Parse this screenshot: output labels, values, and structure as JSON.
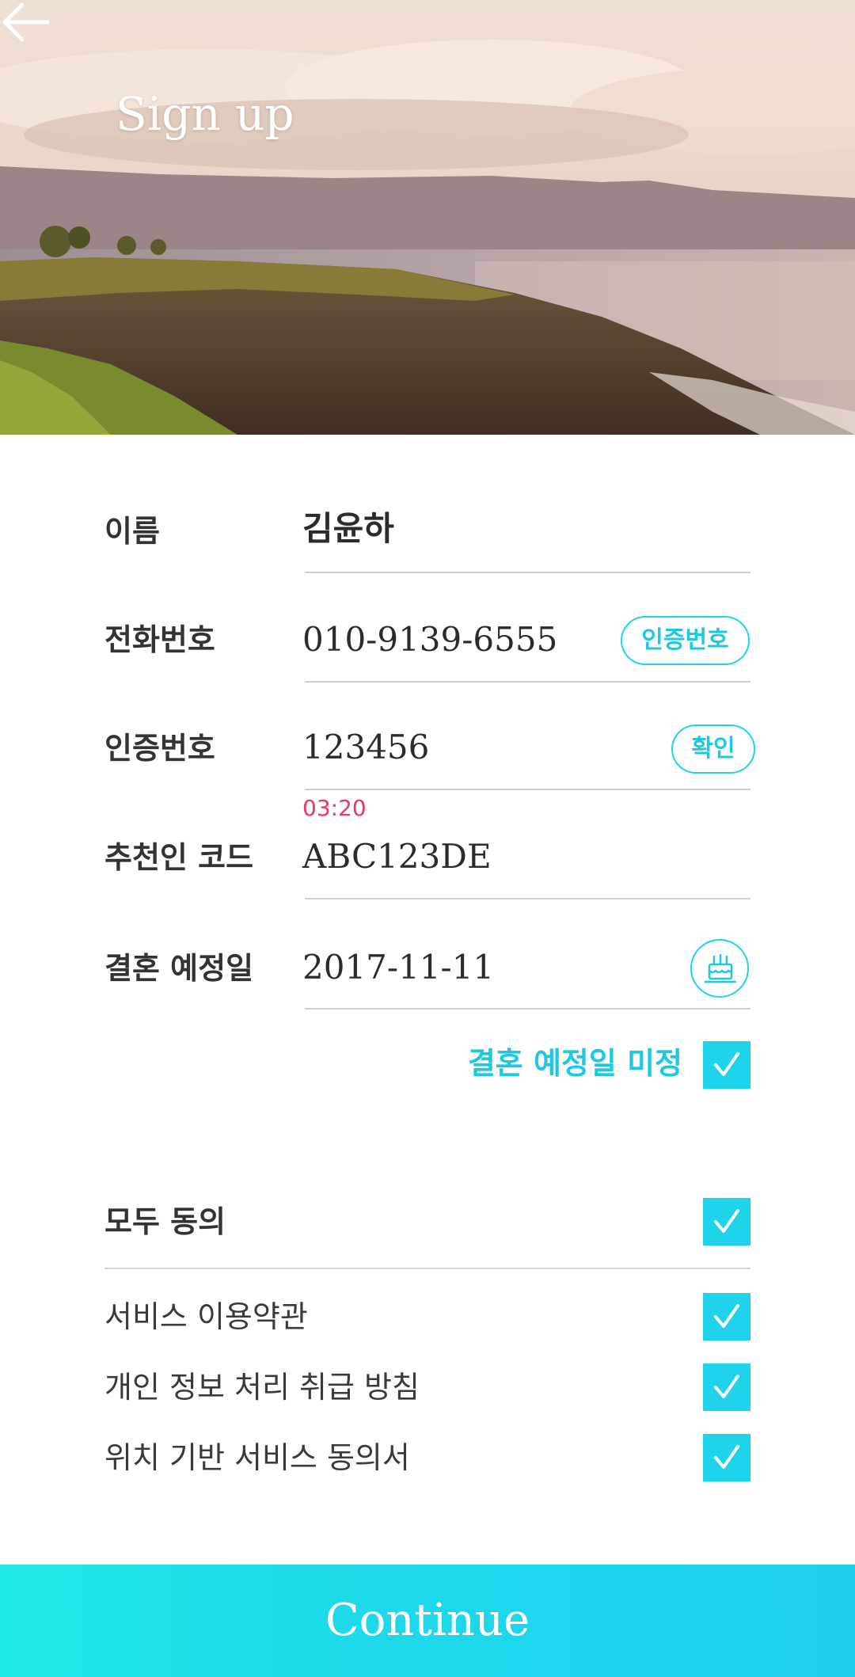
{
  "header": {
    "title": "Sign up"
  },
  "form": {
    "name": {
      "label": "이름",
      "value": "김윤하"
    },
    "phone": {
      "label": "전화번호",
      "value": "010-9139-6555",
      "button": "인증번호"
    },
    "verify": {
      "label": "인증번호",
      "value": "123456",
      "button": "확인",
      "timer": "03:20"
    },
    "referral": {
      "label": "추천인 코드",
      "value": "ABC123DE"
    },
    "wedding": {
      "label": "결혼 예정일",
      "value": "2017-11-11",
      "undecided": "결혼 예정일 미정",
      "undecided_checked": true
    }
  },
  "agreements": {
    "all": {
      "label": "모두 동의",
      "checked": true
    },
    "items": [
      {
        "label": "서비스 이용약관",
        "checked": true
      },
      {
        "label": "개인 정보 처리 취급 방침",
        "checked": true
      },
      {
        "label": "위치 기반 서비스 동의서",
        "checked": true
      }
    ]
  },
  "footer": {
    "continue": "Continue"
  },
  "colors": {
    "accent": "#1fd3ea",
    "timer": "#f0336b"
  },
  "icons": {
    "back": "arrow-left-icon",
    "calendar": "cake-icon",
    "check": "check-icon"
  }
}
